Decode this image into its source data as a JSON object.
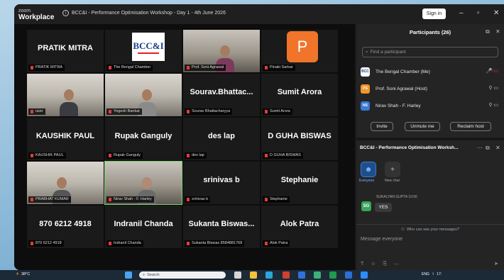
{
  "app": {
    "logo_line1": "zoom",
    "logo_line2": "Workplace",
    "meeting_title": "BCC&I - Performance Optimisation Workshop - Day 1 - 4th June 2026",
    "signin_label": "Sign in"
  },
  "tiles": [
    {
      "name": "PRATIK MITRA",
      "label": "PRATIK MITRA"
    },
    {
      "name": "",
      "label": "The Bengal Chamber",
      "logo": "BCC&I"
    },
    {
      "name": "",
      "label": "Prof. Soni Agrawal"
    },
    {
      "name": "",
      "label": "Pinaki Sarkar",
      "avatar": "P"
    },
    {
      "name": "",
      "label": "user"
    },
    {
      "name": "",
      "label": "Yogesh Bankar"
    },
    {
      "name": "Sourav.Bhattac...",
      "label": "Sourav Bhattacharyya"
    },
    {
      "name": "Sumit Arora",
      "label": "Sumit Arora"
    },
    {
      "name": "KAUSHIK PAUL",
      "label": "KAUSHIK PAUL"
    },
    {
      "name": "Rupak Ganguly",
      "label": "Rupak Ganguly"
    },
    {
      "name": "des lap",
      "label": "des lap"
    },
    {
      "name": "D GUHA BISWAS",
      "label": "D GUHA BISWAS"
    },
    {
      "name": "",
      "label": "PRABHAT KUMAR"
    },
    {
      "name": "",
      "label": "Nirav Shah - F. Harley"
    },
    {
      "name": "srinivas b",
      "label": "srinivas b"
    },
    {
      "name": "Stephanie",
      "label": "Stephanie"
    },
    {
      "name": "870 6212 4918",
      "label": "870 6212 4918"
    },
    {
      "name": "Indranil Chanda",
      "label": "Indranil Chanda"
    },
    {
      "name": "Sukanta Biswas...",
      "label": "Sukanta Biswas 8584881768"
    },
    {
      "name": "Alok Patra",
      "label": "Alok Patra"
    }
  ],
  "participants": {
    "title": "Participants (26)",
    "search_placeholder": "Find a participant",
    "list": [
      {
        "initials": "BCC",
        "name": "The Bengal Chamber (Me)",
        "color": "#ffffff"
      },
      {
        "initials": "PS",
        "name": "Prof. Soni Agrawal (Host)",
        "color": "#f0962a"
      },
      {
        "initials": "NS",
        "name": "Nirav Shah - F. Harley",
        "color": "#3a7bd5"
      }
    ],
    "buttons": [
      "Invite",
      "Unmute me",
      "Reclaim host"
    ]
  },
  "chat": {
    "title": "BCC&I - Performance Optimisation Worksh...",
    "tabs": [
      "Everyone",
      "New chat"
    ],
    "message": {
      "sender": "SUKALYAN GUPTA",
      "time": "10:56",
      "initials": "SG",
      "text": "YES"
    },
    "who_can_see": "Who can see your messages?",
    "input_placeholder": "Message everyone"
  },
  "taskbar": {
    "weather": "38°C",
    "search_placeholder": "Search",
    "lang": "ENG",
    "clock": "17:"
  }
}
